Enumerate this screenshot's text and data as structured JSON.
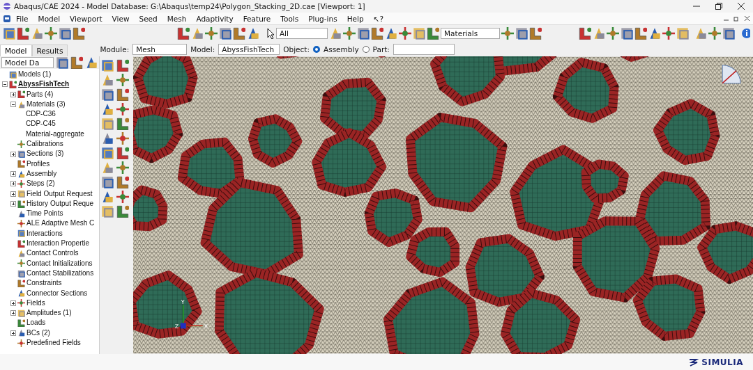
{
  "window": {
    "title": "Abaqus/CAE 2024 - Model Database: G:\\Abaqus\\temp24\\Polygon_Stacking_2D.cae [Viewport: 1]"
  },
  "menu": [
    "File",
    "Model",
    "Viewport",
    "View",
    "Seed",
    "Mesh",
    "Adaptivity",
    "Feature",
    "Tools",
    "Plug-ins",
    "Help",
    "↖?"
  ],
  "toolbar": {
    "selection_filter": "All",
    "color_code": "Materials"
  },
  "tabs": [
    {
      "label": "Model",
      "selected": true
    },
    {
      "label": "Results",
      "selected": false
    }
  ],
  "context_bar": {
    "module_label": "Module:",
    "module": "Mesh",
    "model_label": "Model:",
    "model": "AbyssFishTech",
    "object_label": "Object:",
    "objects": [
      {
        "label": "Assembly",
        "selected": true
      },
      {
        "label": "Part:",
        "selected": false
      }
    ]
  },
  "tree_toolbar": {
    "database": "Model Da"
  },
  "tree": [
    {
      "label": "Models (1)",
      "kind": "root"
    },
    {
      "label": "AbyssFishTech",
      "kind": "model",
      "expanded": true,
      "children": [
        {
          "label": "Parts (4)",
          "expanded": false
        },
        {
          "label": "Materials (3)",
          "expanded": true,
          "children": [
            {
              "label": "CDP-C36"
            },
            {
              "label": "CDP-C45"
            },
            {
              "label": "Material-aggregate"
            }
          ]
        },
        {
          "label": "Calibrations"
        },
        {
          "label": "Sections (3)",
          "expanded": false
        },
        {
          "label": "Profiles"
        },
        {
          "label": "Assembly",
          "expanded": false
        },
        {
          "label": "Steps (2)",
          "expanded": false
        },
        {
          "label": "Field Output Request",
          "expanded": false
        },
        {
          "label": "History Output Reque",
          "expanded": false
        },
        {
          "label": "Time Points"
        },
        {
          "label": "ALE Adaptive Mesh C"
        },
        {
          "label": "Interactions"
        },
        {
          "label": "Interaction Propertie"
        },
        {
          "label": "Contact Controls"
        },
        {
          "label": "Contact Initializations"
        },
        {
          "label": "Contact Stabilizations"
        },
        {
          "label": "Constraints"
        },
        {
          "label": "Connector Sections"
        },
        {
          "label": "Fields",
          "expanded": false
        },
        {
          "label": "Amplitudes (1)",
          "expanded": false
        },
        {
          "label": "Loads"
        },
        {
          "label": "BCs (2)",
          "expanded": false
        },
        {
          "label": "Predefined Fields"
        }
      ]
    }
  ],
  "viewport": {
    "triad": {
      "x": "X",
      "y": "Y",
      "z": "Z"
    }
  },
  "status_bar": {
    "logo_text": "SIMULIA"
  }
}
